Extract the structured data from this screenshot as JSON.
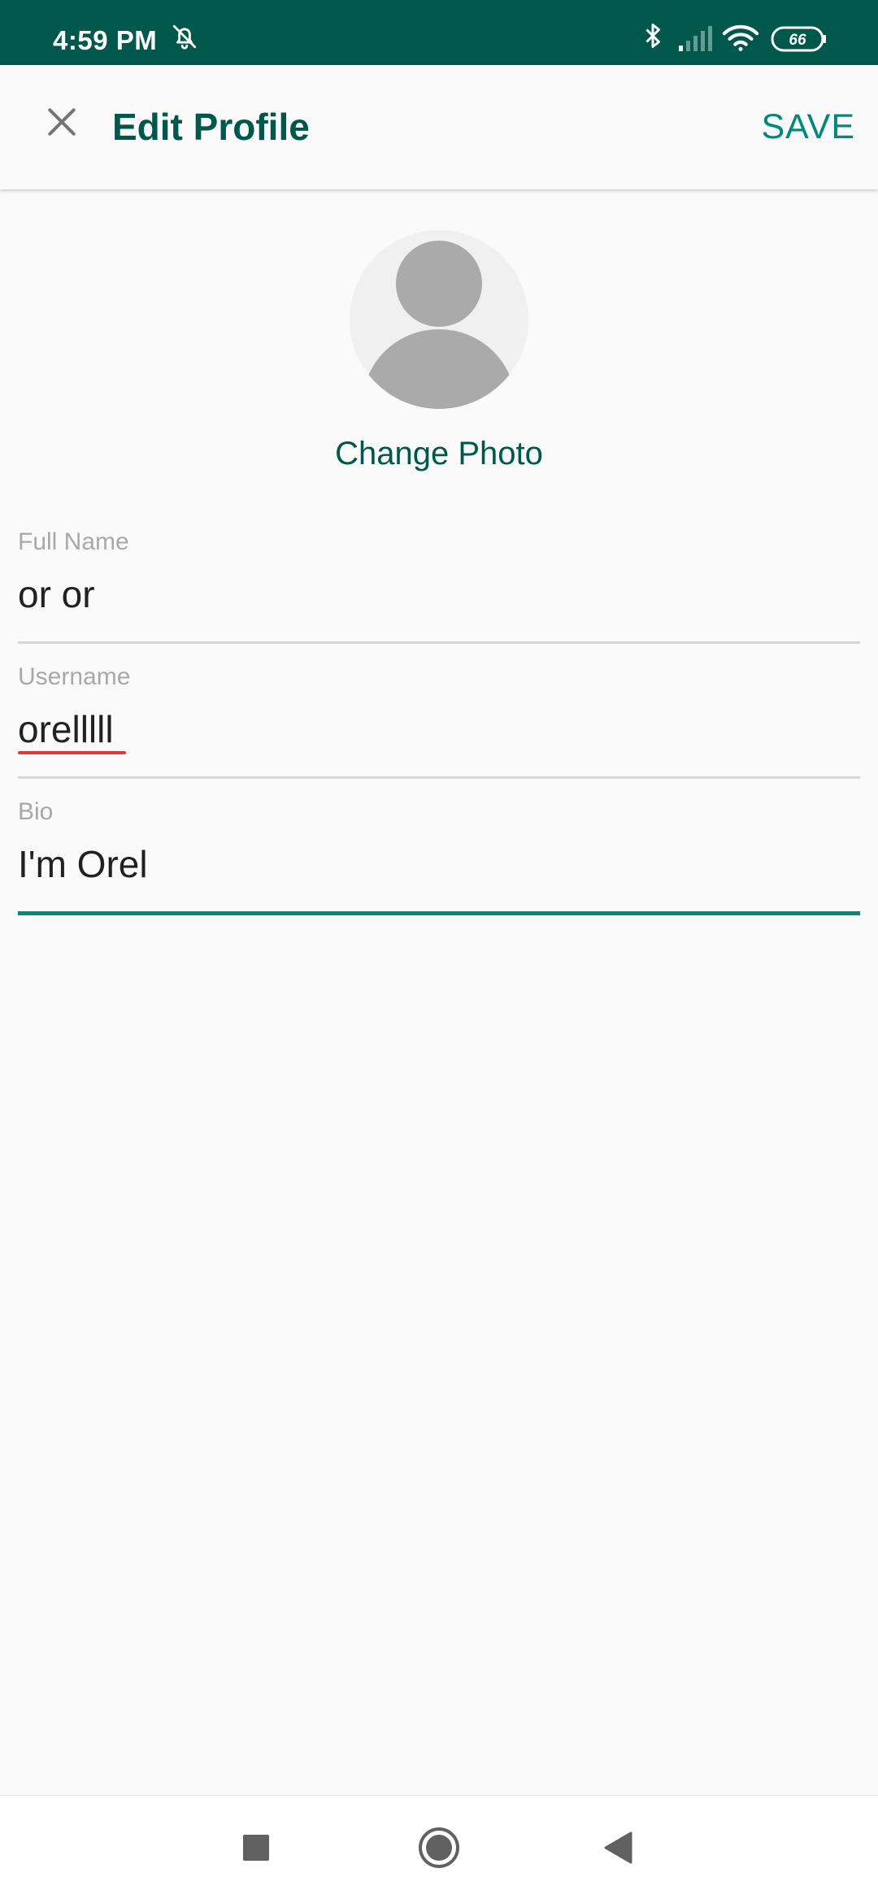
{
  "status_bar": {
    "time": "4:59 PM",
    "battery": "66",
    "icons": [
      "bell-off-icon",
      "bluetooth-icon",
      "signal-icon",
      "wifi-icon",
      "battery-icon"
    ]
  },
  "app_bar": {
    "close_icon": "close-icon",
    "title": "Edit Profile",
    "save_label": "SAVE"
  },
  "profile": {
    "avatar_icon": "default-avatar-icon",
    "change_photo_label": "Change Photo"
  },
  "fields": {
    "full_name": {
      "label": "Full Name",
      "value": "or or"
    },
    "username": {
      "label": "Username",
      "value": "orelllll"
    },
    "bio": {
      "label": "Bio",
      "value": "I'm Orel"
    }
  },
  "nav_bar": {
    "icons": [
      "recents-square-icon",
      "home-circle-icon",
      "back-triangle-icon"
    ]
  },
  "colors": {
    "primary_dark": "#00574b",
    "accent": "#00897b",
    "background": "#fafafa",
    "spellcheck": "#e53935"
  }
}
